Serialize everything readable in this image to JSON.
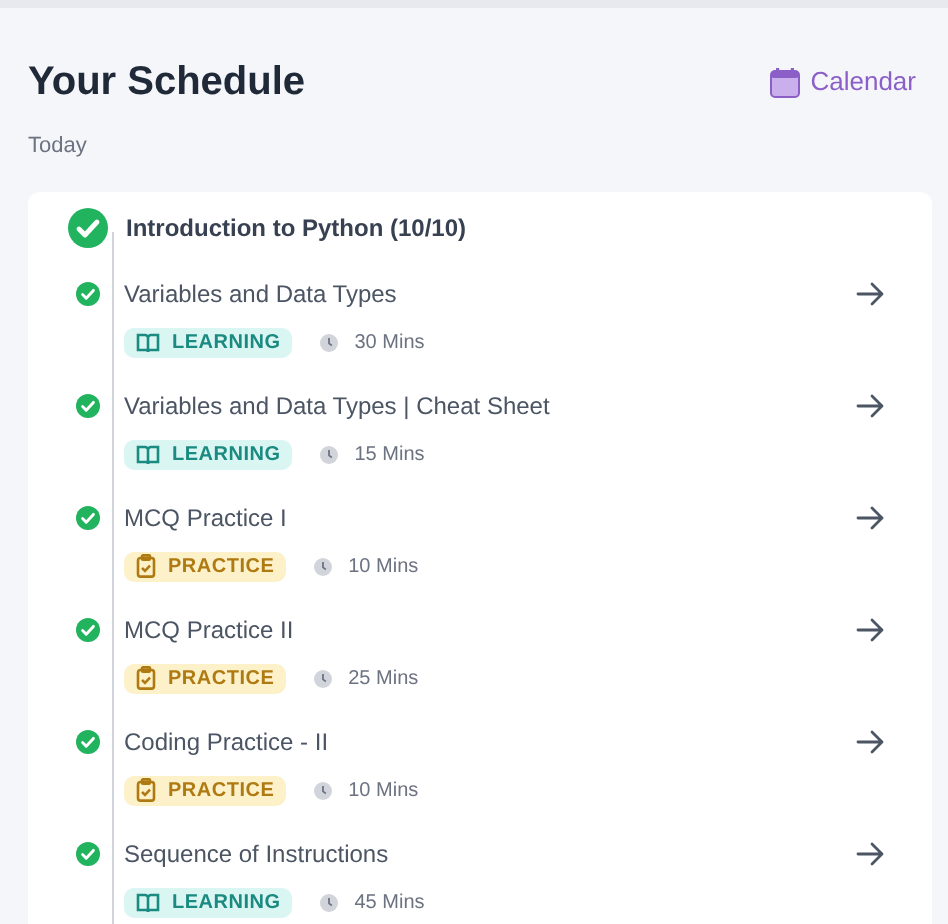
{
  "header": {
    "title": "Your Schedule",
    "calendar_link": "Calendar"
  },
  "day_label": "Today",
  "module": {
    "title": "Introduction to Python (10/10)",
    "completed": true
  },
  "items": [
    {
      "title": "Variables and Data Types",
      "completed": true,
      "kind": "learning",
      "tag": "LEARNING",
      "duration": "30 Mins"
    },
    {
      "title": "Variables and Data Types | Cheat Sheet",
      "completed": true,
      "kind": "learning",
      "tag": "LEARNING",
      "duration": "15 Mins"
    },
    {
      "title": "MCQ Practice I",
      "completed": true,
      "kind": "practice",
      "tag": "PRACTICE",
      "duration": "10 Mins"
    },
    {
      "title": "MCQ Practice II",
      "completed": true,
      "kind": "practice",
      "tag": "PRACTICE",
      "duration": "25 Mins"
    },
    {
      "title": "Coding Practice - II",
      "completed": true,
      "kind": "practice",
      "tag": "PRACTICE",
      "duration": "10 Mins"
    },
    {
      "title": "Sequence of Instructions",
      "completed": true,
      "kind": "learning",
      "tag": "LEARNING",
      "duration": "45 Mins"
    }
  ]
}
